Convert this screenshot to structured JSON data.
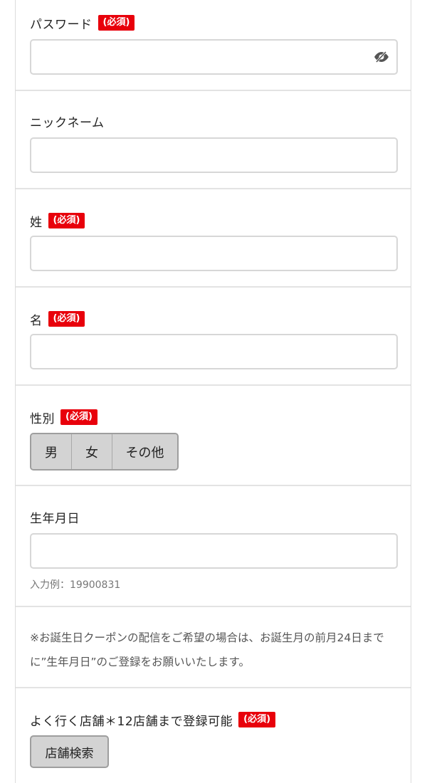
{
  "form": {
    "required_badge": "(必須)",
    "password": {
      "label": "パスワード",
      "value": ""
    },
    "nickname": {
      "label": "ニックネーム",
      "value": ""
    },
    "last_name": {
      "label": "姓",
      "value": ""
    },
    "first_name": {
      "label": "名",
      "value": ""
    },
    "gender": {
      "label": "性別",
      "options": [
        "男",
        "女",
        "その他"
      ]
    },
    "birthday": {
      "label": "生年月日",
      "value": "",
      "hint": "入力例：19900831"
    },
    "birthday_note": "※お誕生日クーポンの配信をご希望の場合は、お誕生月の前月24日までに”生年月日”のご登録をお願いいたします。",
    "store": {
      "label": "よく行く店舗＊12店舗まで登録可能",
      "search_button": "店舗検索"
    }
  },
  "icons": {
    "password_toggle": "eye-slash-icon"
  },
  "colors": {
    "required_badge_bg": "#e8000b",
    "button_bg": "#d3d3d3",
    "input_border": "#d7d7d7"
  }
}
